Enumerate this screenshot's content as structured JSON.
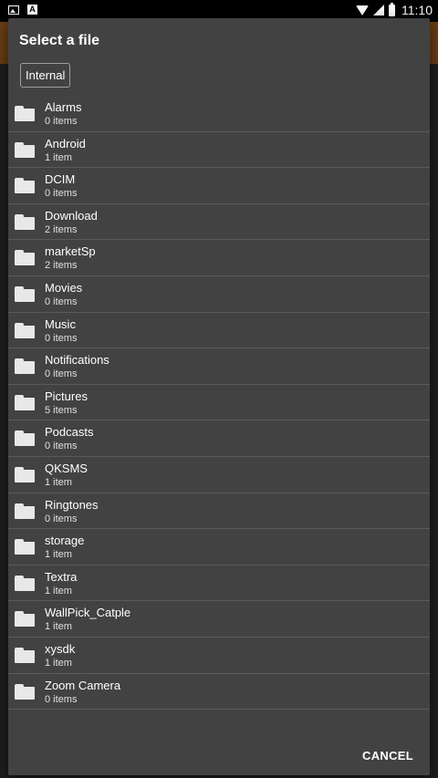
{
  "status_bar": {
    "time": "11:10",
    "left_icons": [
      "image-icon",
      "a-icon"
    ],
    "right_icons": [
      "wifi-icon",
      "signal-icon",
      "battery-icon"
    ]
  },
  "dialog": {
    "title": "Select a file",
    "location_chip": "Internal",
    "cancel_label": "CANCEL",
    "items": [
      {
        "name": "Alarms",
        "count": "0 items"
      },
      {
        "name": "Android",
        "count": "1 item"
      },
      {
        "name": "DCIM",
        "count": "0 items"
      },
      {
        "name": "Download",
        "count": "2 items"
      },
      {
        "name": "marketSp",
        "count": "2 items"
      },
      {
        "name": "Movies",
        "count": "0 items"
      },
      {
        "name": "Music",
        "count": "0 items"
      },
      {
        "name": "Notifications",
        "count": "0 items"
      },
      {
        "name": "Pictures",
        "count": "5 items"
      },
      {
        "name": "Podcasts",
        "count": "0 items"
      },
      {
        "name": "QKSMS",
        "count": "1 item"
      },
      {
        "name": "Ringtones",
        "count": "0 items"
      },
      {
        "name": "storage",
        "count": "1 item"
      },
      {
        "name": "Textra",
        "count": "1 item"
      },
      {
        "name": "WallPick_Catple",
        "count": "1 item"
      },
      {
        "name": "xysdk",
        "count": "1 item"
      },
      {
        "name": "Zoom Camera",
        "count": "0 items"
      }
    ]
  },
  "colors": {
    "dialog_bg": "#424242",
    "app_bar": "#6b3f14",
    "status_bar": "#000000",
    "divider": "#5a5a5a",
    "folder_icon": "#e8e8e8"
  }
}
